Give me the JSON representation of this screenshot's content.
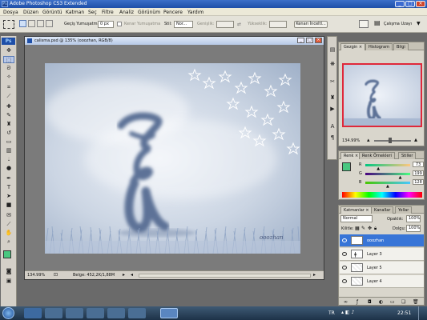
{
  "window": {
    "title": "Adobe Photoshop CS3 Extended",
    "app_badge": "Ps"
  },
  "menu": [
    "Dosya",
    "Düzen",
    "Görüntü",
    "Katman",
    "Seç",
    "Filtre",
    "Analiz",
    "Görünüm",
    "Pencere",
    "Yardım"
  ],
  "options": {
    "feather_label": "Geçiş Yumuşatma:",
    "feather_value": "0 px",
    "antialias_label": "Kenar Yumuşatma",
    "style_label": "Stil:",
    "style_value": "Nor...",
    "width_label": "Genişlik:",
    "height_label": "Yükseklik:",
    "refine_button": "Kenarı İnceltl...",
    "workspace_button": "Çalışma Uzayı"
  },
  "document": {
    "tab_title": "calisma.psd @ 135% (ooozhan, RGB/8)",
    "zoom": "134.99%",
    "doc_info": "Belge: 452,2K/1,88M",
    "signature": "ooozhan"
  },
  "navigator": {
    "tabs": [
      "Gezgin",
      "Histogram",
      "Bilgi"
    ],
    "zoom": "134.99%"
  },
  "color_panel": {
    "tabs": [
      "Renk",
      "Renk Örnekleri",
      "Stiller"
    ],
    "channels": [
      {
        "label": "R",
        "value": "73",
        "fraction": 0.29
      },
      {
        "label": "G",
        "value": "199",
        "fraction": 0.78
      },
      {
        "label": "B",
        "value": "128",
        "fraction": 0.5
      }
    ],
    "foreground_color": "#49c780"
  },
  "layers_panel": {
    "tabs": [
      "Katmanlar",
      "Kanallar",
      "Yollar"
    ],
    "blend_mode": "Normal",
    "opacity_label": "Opaklık:",
    "opacity_value": "100%",
    "lock_label": "Kilitle:",
    "fill_label": "Dolgu:",
    "fill_value": "100%",
    "layers": [
      {
        "name": "ooozhan",
        "selected": true
      },
      {
        "name": "Layer 3",
        "selected": false
      },
      {
        "name": "Layer 5",
        "selected": false
      },
      {
        "name": "Layer 4",
        "selected": false
      }
    ]
  },
  "taskbar": {
    "language": "TR",
    "clock": "22:51"
  }
}
